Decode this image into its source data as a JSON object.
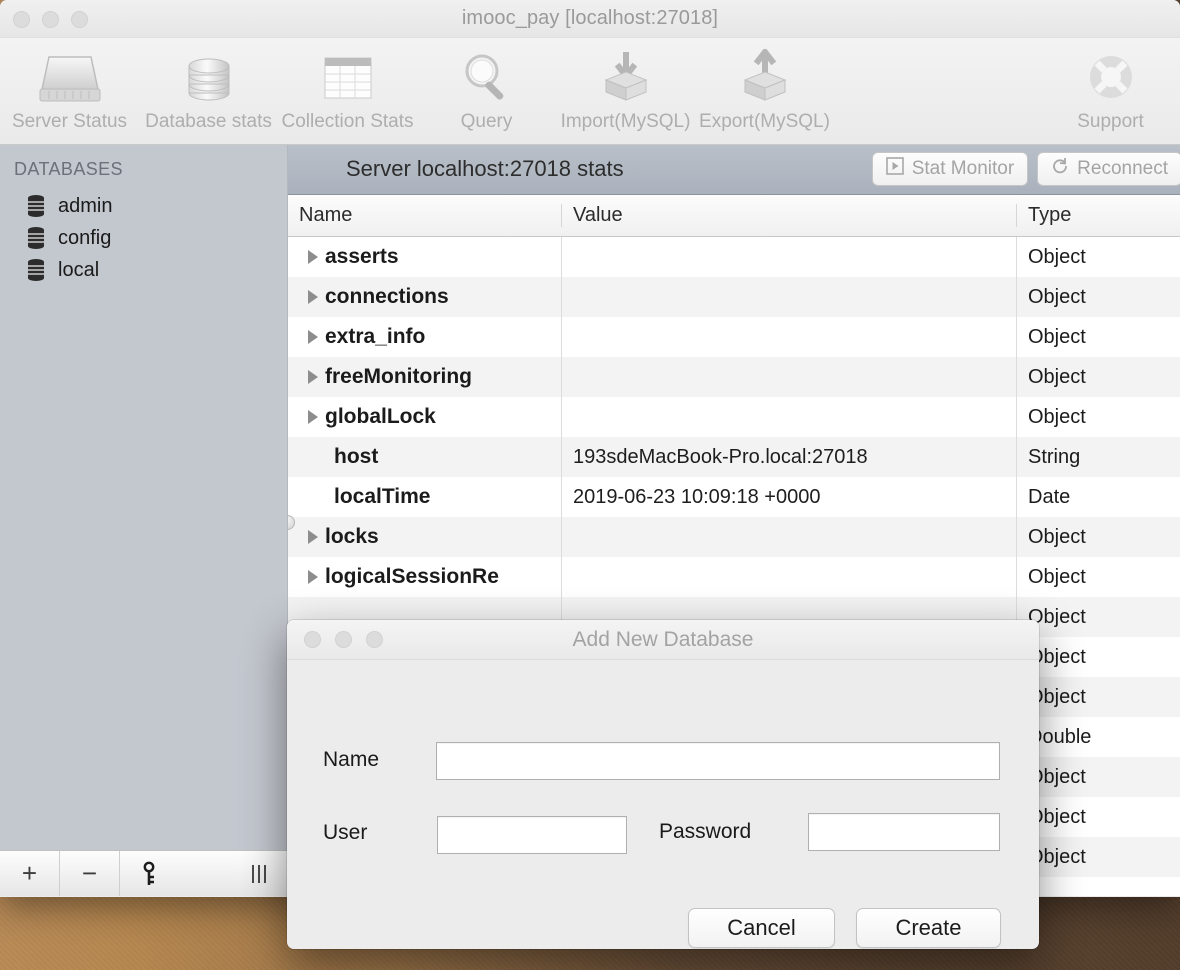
{
  "window": {
    "title": "imooc_pay [localhost:27018]"
  },
  "toolbar": {
    "items": [
      {
        "label": "Server Status",
        "icon": "server-icon"
      },
      {
        "label": "Database stats",
        "icon": "database-stack-icon"
      },
      {
        "label": "Collection Stats",
        "icon": "table-grid-icon"
      },
      {
        "label": "Query",
        "icon": "magnifier-icon"
      },
      {
        "label": "Import(MySQL)",
        "icon": "import-cube-icon"
      },
      {
        "label": "Export(MySQL)",
        "icon": "export-cube-icon"
      },
      {
        "label": "Support",
        "icon": "lifebuoy-icon"
      }
    ]
  },
  "sidebar": {
    "header": "DATABASES",
    "items": [
      {
        "label": "admin",
        "icon": "database-icon"
      },
      {
        "label": "config",
        "icon": "database-icon"
      },
      {
        "label": "local",
        "icon": "database-icon"
      }
    ],
    "footer": {
      "add": "+",
      "remove": "−",
      "key": "key-icon",
      "grip": "grip-icon"
    }
  },
  "stats": {
    "title": "Server localhost:27018 stats",
    "buttons": [
      {
        "label": "Stat Monitor",
        "icon": "play-icon"
      },
      {
        "label": "Reconnect",
        "icon": "refresh-icon"
      }
    ],
    "columns": [
      "Name",
      "Value",
      "Type"
    ],
    "rows": [
      {
        "name": "asserts",
        "expandable": true,
        "value": "",
        "type": "Object"
      },
      {
        "name": "connections",
        "expandable": true,
        "value": "",
        "type": "Object"
      },
      {
        "name": "extra_info",
        "expandable": true,
        "value": "",
        "type": "Object"
      },
      {
        "name": "freeMonitoring",
        "expandable": true,
        "value": "",
        "type": "Object"
      },
      {
        "name": "globalLock",
        "expandable": true,
        "value": "",
        "type": "Object"
      },
      {
        "name": "host",
        "expandable": false,
        "value": "193sdeMacBook-Pro.local:27018",
        "type": "String"
      },
      {
        "name": "localTime",
        "expandable": false,
        "value": "2019-06-23 10:09:18 +0000",
        "type": "Date"
      },
      {
        "name": "locks",
        "expandable": true,
        "value": "",
        "type": "Object"
      },
      {
        "name": "logicalSessionRe",
        "expandable": true,
        "value": "",
        "type": "Object"
      },
      {
        "name": "",
        "expandable": false,
        "value": "",
        "type": "Object"
      },
      {
        "name": "",
        "expandable": false,
        "value": "",
        "type": "Object"
      },
      {
        "name": "",
        "expandable": false,
        "value": "",
        "type": "Object"
      },
      {
        "name": "",
        "expandable": false,
        "value": "",
        "type": "Double"
      },
      {
        "name": "",
        "expandable": false,
        "value": "",
        "type": "Object"
      },
      {
        "name": "",
        "expandable": false,
        "value": "",
        "type": "Object"
      },
      {
        "name": "",
        "expandable": false,
        "value": "",
        "type": "Object"
      }
    ]
  },
  "dialog": {
    "title": "Add New Database",
    "fields": {
      "name_label": "Name",
      "name_value": "",
      "name_placeholder": "",
      "user_label": "User",
      "user_value": "",
      "user_placeholder": "",
      "password_label": "Password",
      "password_value": "",
      "password_placeholder": ""
    },
    "cancel_label": "Cancel",
    "create_label": "Create"
  },
  "colors": {
    "sidebar_bg": "#c3c7ce",
    "stats_bar": "#a9b1bc",
    "desktop_light": "#b8895a",
    "desktop_dark": "#55402c"
  }
}
